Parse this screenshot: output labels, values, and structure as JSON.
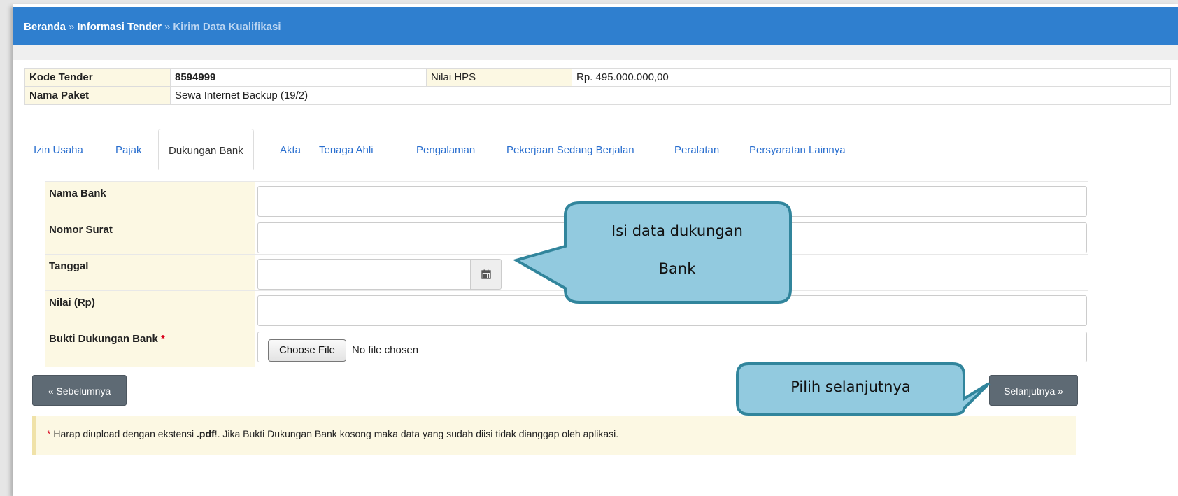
{
  "breadcrumb": {
    "home": "Beranda",
    "sep1": "»",
    "info": "Informasi Tender",
    "sep2": "»",
    "current": "Kirim Data Kualifikasi"
  },
  "info_table": {
    "kode_label": "Kode Tender",
    "kode_value": "8594999",
    "hps_label": "Nilai HPS",
    "hps_value": "Rp. 495.000.000,00",
    "nama_label": "Nama Paket",
    "nama_value": "Sewa Internet Backup (19/2)"
  },
  "tabs": [
    "Izin Usaha",
    "Pajak",
    "Dukungan Bank",
    "Akta",
    "Tenaga Ahli",
    "Pengalaman",
    "Pekerjaan Sedang Berjalan",
    "Peralatan",
    "Persyaratan Lainnya"
  ],
  "active_tab": "Dukungan Bank",
  "form": {
    "nama_bank": "Nama Bank",
    "nomor_surat": "Nomor Surat",
    "tanggal": "Tanggal",
    "nilai": "Nilai (Rp)",
    "bukti": "Bukti Dukungan Bank",
    "required_mark": "*",
    "choose_file": "Choose File",
    "no_file": "No file chosen"
  },
  "buttons": {
    "prev": "« Sebelumnya",
    "next": "Selanjutnya »"
  },
  "note": {
    "star": "*",
    "text1": " Harap diupload dengan ekstensi ",
    "ext": ".pdf",
    "text2": "!. Jika Bukti Dukungan Bank kosong maka data yang sudah diisi tidak dianggap oleh aplikasi."
  },
  "callouts": {
    "fill_line1": "Isi data dukungan",
    "fill_line2": "Bank",
    "next_hint": "Pilih selanjutnya"
  },
  "colors": {
    "header_blue": "#2f7fcf",
    "label_bg": "#fcf8e3",
    "link_blue": "#2a6fcf",
    "callout_fill": "#92cadf",
    "callout_border": "#31859c",
    "button_dark": "#5e6a74"
  },
  "icons": {
    "calendar": "calendar-icon"
  }
}
